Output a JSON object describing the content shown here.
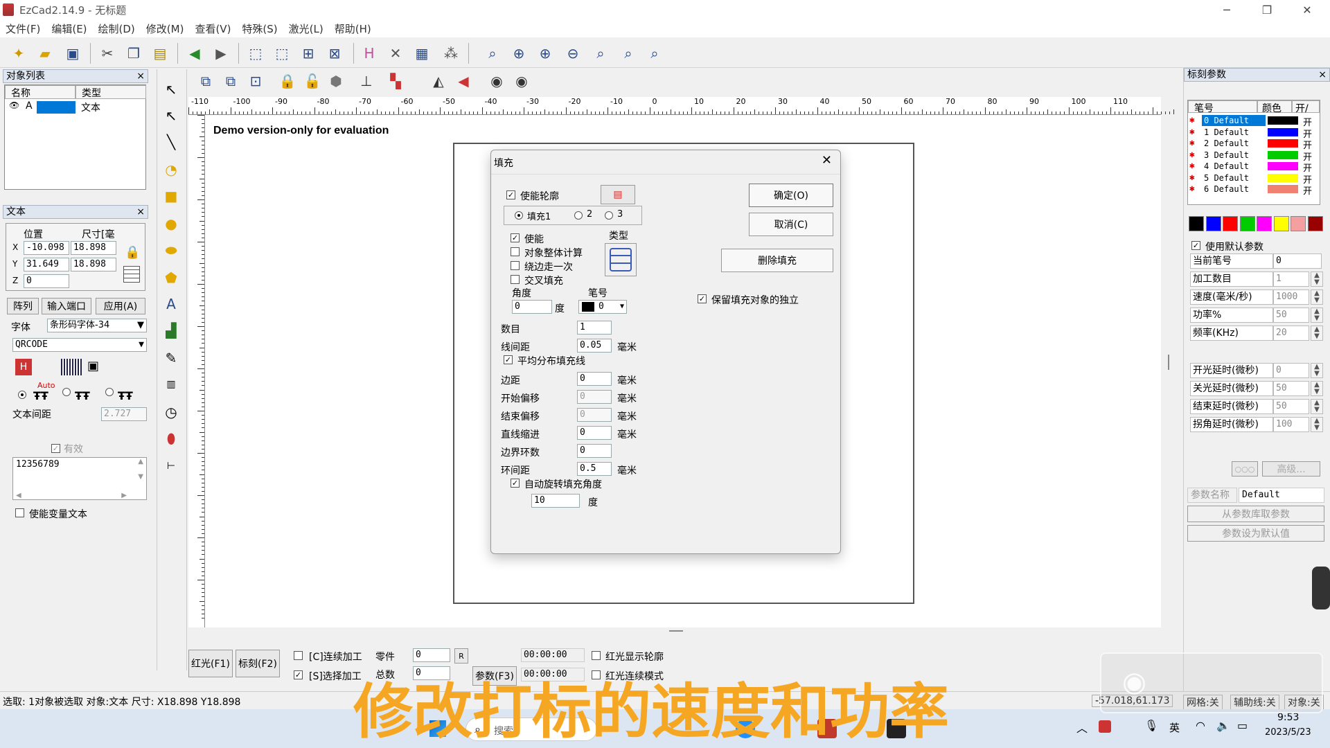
{
  "window": {
    "title": "EzCad2.14.9 - 无标题"
  },
  "menu": [
    "文件(F)",
    "编辑(E)",
    "绘制(D)",
    "修改(M)",
    "查看(V)",
    "特殊(S)",
    "激光(L)",
    "帮助(H)"
  ],
  "object_list": {
    "title": "对象列表",
    "col_name": "名称",
    "col_type": "类型",
    "row_name": "A",
    "row_type": "文本"
  },
  "text_panel": {
    "title": "文本",
    "pos_label": "位置",
    "size_label": "尺寸[毫",
    "x_label": "X",
    "y_label": "Y",
    "z_label": "Z",
    "x_pos": "-10.098",
    "x_size": "18.898",
    "y_pos": "31.649",
    "y_size": "18.898",
    "z_pos": "0",
    "array_btn": "阵列",
    "input_port_btn": "输入端口",
    "apply_btn": "应用(A)",
    "font_label": "字体",
    "font_value": "条形码字体-34",
    "barcode_type": "QRCODE",
    "auto_label": "Auto",
    "spacing_label": "文本间距",
    "spacing_value": "2.727",
    "valid_label": "有效",
    "text_content": "12356789",
    "var_text_label": "使能变量文本"
  },
  "canvas": {
    "watermark": "Demo version-only for evaluation",
    "ruler_labels": [
      "-110",
      "-100",
      "-90",
      "-80",
      "-70",
      "-60",
      "-50",
      "-40",
      "-30",
      "-20",
      "-10",
      "0",
      "10",
      "20",
      "30",
      "40",
      "50",
      "60",
      "70",
      "80",
      "90",
      "100",
      "110"
    ]
  },
  "fill_dialog": {
    "title": "填充",
    "enable_contour": "使能轮廓",
    "fill1": "填充1",
    "fill2": "2",
    "fill3": "3",
    "enable": "使能",
    "type_label": "类型",
    "whole_object_calc": "对象整体计算",
    "walk_edge_once": "绕边走一次",
    "cross_fill": "交叉填充",
    "angle_label": "角度",
    "angle_value": "0",
    "degree_unit": "度",
    "pen_label": "笔号",
    "pen_value": "0",
    "count_label": "数目",
    "count_value": "1",
    "line_spacing_label": "线间距",
    "line_spacing_value": "0.05",
    "mm_unit": "毫米",
    "even_distribute": "平均分布填充线",
    "margin_label": "边距",
    "margin_value": "0",
    "start_offset_label": "开始偏移",
    "start_offset_value": "0",
    "end_offset_label": "结束偏移",
    "end_offset_value": "0",
    "line_indent_label": "直线缩进",
    "line_indent_value": "0",
    "border_loops_label": "边界环数",
    "border_loops_value": "0",
    "loop_spacing_label": "环间距",
    "loop_spacing_value": "0.5",
    "auto_rotate": "自动旋转填充角度",
    "auto_rotate_value": "10",
    "ok_btn": "确定(O)",
    "cancel_btn": "取消(C)",
    "delete_fill_btn": "删除填充",
    "keep_independent": "保留填充对象的独立"
  },
  "bottom_bar": {
    "red_light_btn": "红光(F1)",
    "mark_btn": "标刻(F2)",
    "continuous_label": "[C]连续加工",
    "selected_label": "[S]选择加工",
    "parts_label": "零件",
    "parts_value": "0",
    "r_btn": "R",
    "total_label": "总数",
    "total_value": "0",
    "time1": "00:00:00",
    "params_btn": "参数(F3)",
    "time2": "00:00:00",
    "red_contour_label": "红光显示轮廓",
    "red_continuous_label": "红光连续模式"
  },
  "mark_params": {
    "title": "标刻参数",
    "col_pen": "笔号",
    "col_color": "颜色",
    "col_onoff": "开/",
    "pens": [
      {
        "name": "0 Default",
        "color": "#000000",
        "state": "开"
      },
      {
        "name": "1 Default",
        "color": "#0000ff",
        "state": "开"
      },
      {
        "name": "2 Default",
        "color": "#ff0000",
        "state": "开"
      },
      {
        "name": "3 Default",
        "color": "#00cc00",
        "state": "开"
      },
      {
        "name": "4 Default",
        "color": "#ff00ff",
        "state": "开"
      },
      {
        "name": "5 Default",
        "color": "#ffff00",
        "state": "开"
      },
      {
        "name": "6 Default",
        "color": "#f08070",
        "state": "开"
      }
    ],
    "palette": [
      "#000000",
      "#0000ff",
      "#ff0000",
      "#00cc00",
      "#ff00ff",
      "#ffff00",
      "#f4a0a0",
      "#990000"
    ],
    "use_default": "使用默认参数",
    "current_pen_label": "当前笔号",
    "current_pen_value": "0",
    "loop_count_label": "加工数目",
    "loop_count_value": "1",
    "speed_label": "速度(毫米/秒)",
    "speed_value": "1000",
    "power_label": "功率%",
    "power_value": "50",
    "freq_label": "频率(KHz)",
    "freq_value": "20",
    "laser_on_delay_label": "开光延时(微秒)",
    "laser_on_delay_value": "0",
    "laser_off_delay_label": "关光延时(微秒)",
    "laser_off_delay_value": "50",
    "end_delay_label": "结束延时(微秒)",
    "end_delay_value": "50",
    "corner_delay_label": "拐角延时(微秒)",
    "corner_delay_value": "100",
    "advanced_btn": "高级...",
    "param_name_label": "参数名称",
    "param_name_value": "Default",
    "from_library_btn": "从参数库取参数",
    "set_default_btn": "参数设为默认值"
  },
  "status": {
    "text": "选取: 1对象被选取 对象:文本 尺寸: X18.898 Y18.898",
    "coords": "-57.018,61.173",
    "grid": "网格:关",
    "guide": "辅助线:关",
    "object": "对象:关"
  },
  "subtitle": "修改打标的速度和功率",
  "taskbar": {
    "search": "搜索",
    "ime": "英",
    "time": "9:53",
    "date": "2023/5/23"
  }
}
